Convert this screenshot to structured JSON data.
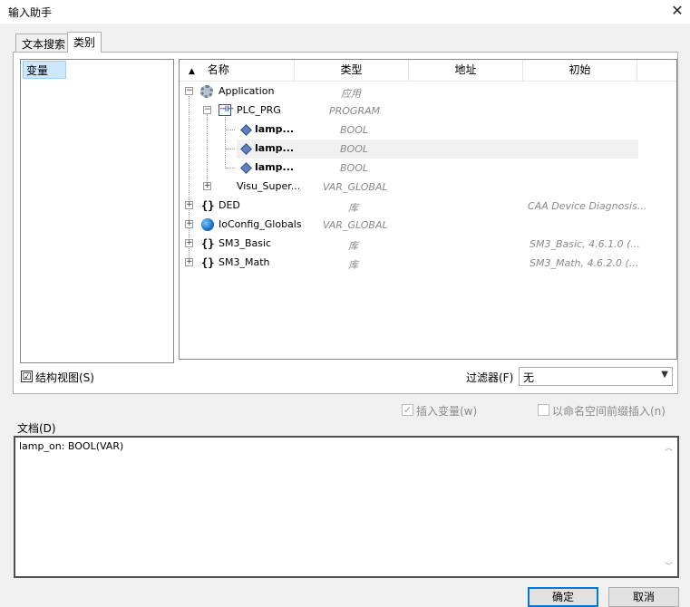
{
  "window": {
    "title": "输入助手",
    "close_icon": "close-icon"
  },
  "tabs": [
    {
      "label": "文本搜索"
    },
    {
      "label": "类别"
    }
  ],
  "categories": [
    {
      "label": "变量"
    }
  ],
  "tree": {
    "columns": [
      {
        "label": "名称"
      },
      {
        "label": "类型"
      },
      {
        "label": "地址"
      },
      {
        "label": "初始"
      }
    ],
    "rows": [
      {
        "name": "Application",
        "type": "应用",
        "init": ""
      },
      {
        "name": "PLC_PRG",
        "type": "PROGRAM",
        "init": ""
      },
      {
        "name": "lamp...",
        "type": "BOOL",
        "init": ""
      },
      {
        "name": "lamp...",
        "type": "BOOL",
        "init": ""
      },
      {
        "name": "lamp...",
        "type": "BOOL",
        "init": ""
      },
      {
        "name": "Visu_Super...",
        "type": "VAR_GLOBAL",
        "init": ""
      },
      {
        "name": "DED",
        "type": "库",
        "init": "CAA Device Diagnosis..."
      },
      {
        "name": "IoConfig_Globals",
        "type": "VAR_GLOBAL",
        "init": ""
      },
      {
        "name": "SM3_Basic",
        "type": "库",
        "init": "SM3_Basic, 4.6.1.0 (..."
      },
      {
        "name": "SM3_Math",
        "type": "库",
        "init": "SM3_Math, 4.6.2.0 (..."
      }
    ]
  },
  "structured_view": {
    "label": "结构视图(S)",
    "checked": "☑"
  },
  "filter": {
    "label": "过滤器(F)",
    "value": "无"
  },
  "insert_var": {
    "label": "插入变量(w)",
    "checked": "✓"
  },
  "namespace_prefix": {
    "label": "以命名空间前缀插入(n)"
  },
  "documentation": {
    "label": "文档(D)",
    "text": "lamp_on: BOOL(VAR)"
  },
  "buttons": {
    "ok": "确定",
    "cancel": "取消"
  }
}
